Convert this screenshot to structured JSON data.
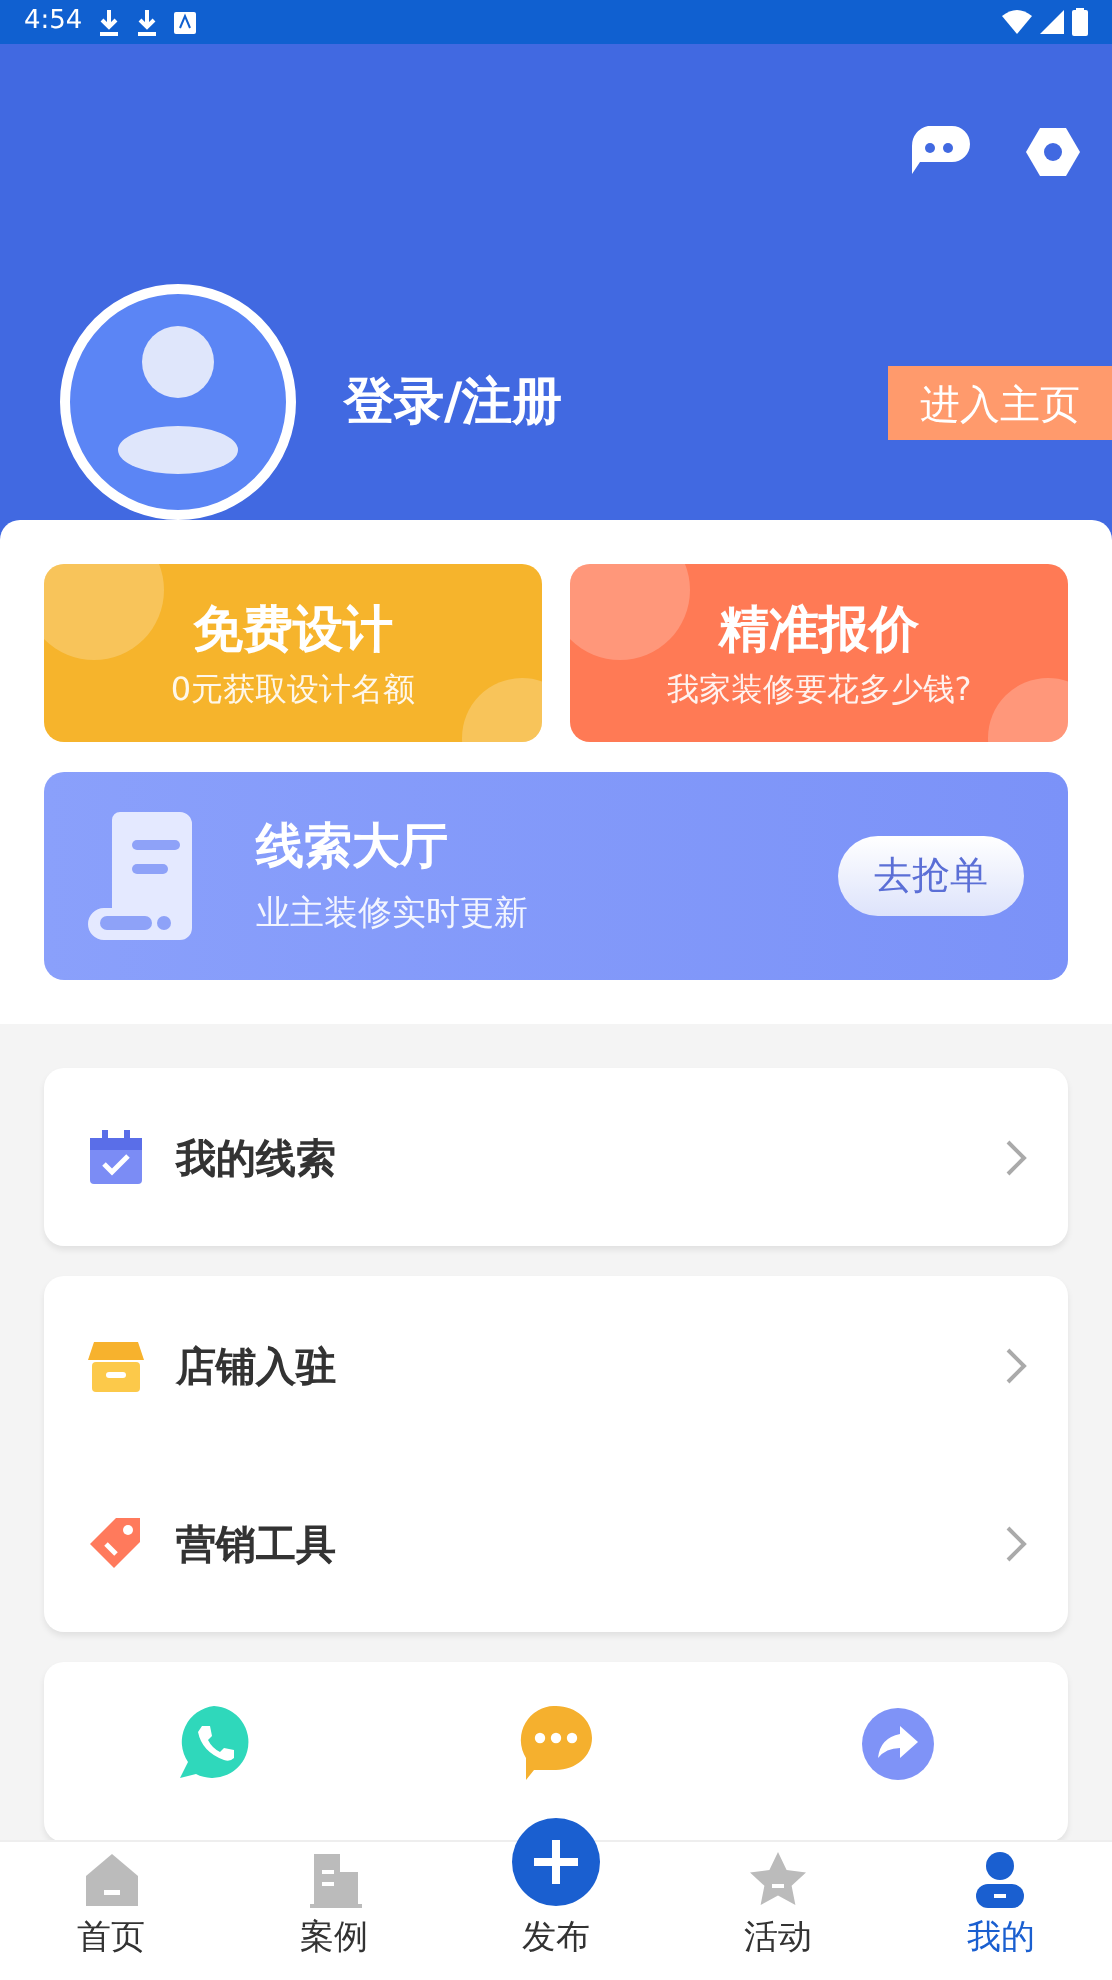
{
  "status_bar": {
    "time": "4:54"
  },
  "profile": {
    "login_label": "登录/注册",
    "home_button": "进入主页"
  },
  "promo_cards": [
    {
      "title": "免费设计",
      "subtitle": "0元获取设计名额",
      "color": "#f6b42c"
    },
    {
      "title": "精准报价",
      "subtitle": "我家装修要花多少钱?",
      "color": "#ff7a55"
    }
  ],
  "lead_banner": {
    "title": "线索大厅",
    "subtitle": "业主装修实时更新",
    "button": "去抢单"
  },
  "menu_groups": [
    [
      {
        "label": "我的线索"
      }
    ],
    [
      {
        "label": "店铺入驻"
      },
      {
        "label": "营销工具"
      }
    ]
  ],
  "quick_actions": [
    {
      "color": "#2fd8bb"
    },
    {
      "color": "#f5b02e"
    },
    {
      "color": "#7f93f7"
    }
  ],
  "tab_bar": [
    {
      "label": "首页",
      "selected": false
    },
    {
      "label": "案例",
      "selected": false
    },
    {
      "label": "发布",
      "selected": false
    },
    {
      "label": "活动",
      "selected": false
    },
    {
      "label": "我的",
      "selected": true
    }
  ]
}
